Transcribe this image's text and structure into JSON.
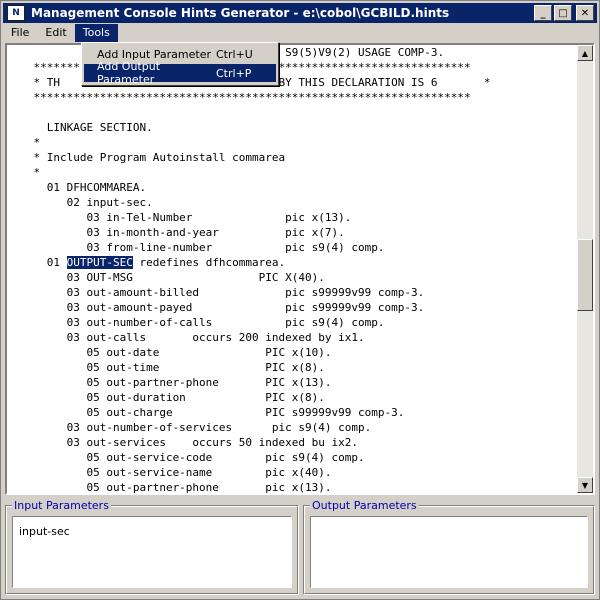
{
  "window": {
    "title": "Management Console Hints Generator - e:\\cobol\\GCBILD.hints",
    "icon_text": "N",
    "buttons": {
      "minimize": "_",
      "maximize": "□",
      "close": "✕"
    }
  },
  "menubar": {
    "items": [
      {
        "label": "File"
      },
      {
        "label": "Edit"
      },
      {
        "label": "Tools"
      }
    ]
  },
  "tools_menu": {
    "items": [
      {
        "label": "Add Input Parameter",
        "shortcut": "Ctrl+U"
      },
      {
        "label": "Add Output Parameter",
        "shortcut": "Ctrl+P"
      }
    ]
  },
  "editor": {
    "lines": [
      "                                          S9(5)V9(2) USAGE COMP-3.",
      "    ******************************************************************",
      "    * TH                               D BY THIS DECLARATION IS 6       *",
      "    ******************************************************************",
      "",
      "      LINKAGE SECTION.",
      "    *",
      "    * Include Program Autoinstall commarea",
      "    *",
      "      01 DFHCOMMAREA.",
      "         02 input-sec.",
      "            03 in-Tel-Number              pic x(13).",
      "            03 in-month-and-year          pic x(7).",
      "            03 from-line-number           pic s9(4) comp.",
      "      01 ",
      "         03 OUT-MSG                   PIC X(40).",
      "         03 out-amount-billed             pic s99999v99 comp-3.",
      "         03 out-amount-payed              pic s99999v99 comp-3.",
      "         03 out-number-of-calls           pic s9(4) comp.",
      "         03 out-calls       occurs 200 indexed by ix1.",
      "            05 out-date                PIC x(10).",
      "            05 out-time                PIC x(8).",
      "            05 out-partner-phone       PIC x(13).",
      "            05 out-duration            PIC x(8).",
      "            05 out-charge              PIC s99999v99 comp-3.",
      "         03 out-number-of-services      pic s9(4) comp.",
      "         03 out-services    occurs 50 indexed bu ix2.",
      "            05 out-service-code        pic s9(4) comp.",
      "            05 out-service-name        pic x(40).",
      "            05 out-partner-phone       pic x(13)."
    ],
    "highlight_line": {
      "prefix": "      01 ",
      "selected": "OUTPUT-SEC",
      "suffix": " redefines dfhcommarea."
    }
  },
  "panels": {
    "input": {
      "title": "Input Parameters",
      "items": [
        "input-sec"
      ]
    },
    "output": {
      "title": "Output Parameters",
      "items": []
    }
  },
  "colors": {
    "title_bar": "#0a246a",
    "selection": "#0a246a",
    "panel_title": "#0000b0",
    "face": "#d4d0c8"
  }
}
